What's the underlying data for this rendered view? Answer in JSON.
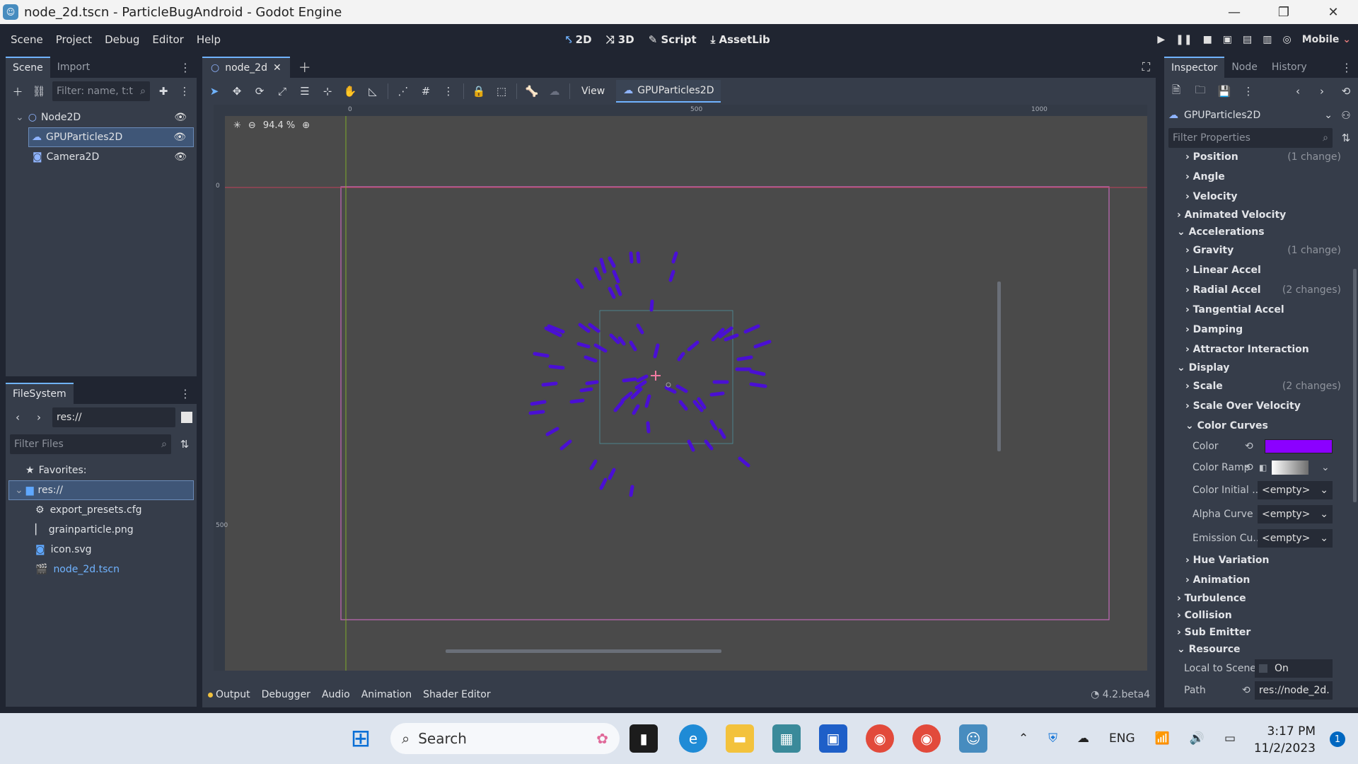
{
  "window": {
    "title": "node_2d.tscn - ParticleBugAndroid - Godot Engine",
    "minimize": "—",
    "restore": "❐",
    "close": "✕"
  },
  "menu": {
    "items": [
      "Scene",
      "Project",
      "Debug",
      "Editor",
      "Help"
    ],
    "workspaces": [
      "2D",
      "3D",
      "Script",
      "AssetLib"
    ],
    "active_workspace": "2D",
    "renderer": "Mobile"
  },
  "scene_dock": {
    "tabs": [
      "Scene",
      "Import"
    ],
    "filter_placeholder": "Filter: name, t:t",
    "nodes": [
      {
        "name": "Node2D",
        "type": "node2d"
      },
      {
        "name": "GPUParticles2D",
        "type": "particles",
        "selected": true
      },
      {
        "name": "Camera2D",
        "type": "camera"
      }
    ]
  },
  "filesystem": {
    "tab": "FileSystem",
    "path": "res://",
    "filter_placeholder": "Filter Files",
    "favorites_label": "Favorites:",
    "root": "res://",
    "files": [
      "export_presets.cfg",
      "grainparticle.png",
      "icon.svg",
      "node_2d.tscn"
    ]
  },
  "editor": {
    "tab": "node_2d",
    "view_label": "View",
    "selected_node": "GPUParticles2D",
    "zoom": "94.4 %",
    "ruler_marks": [
      "0",
      "500",
      "1000"
    ],
    "ruler_left_marks": [
      "0",
      "500"
    ]
  },
  "bottom_panel": {
    "tabs": [
      "Output",
      "Debugger",
      "Audio",
      "Animation",
      "Shader Editor"
    ],
    "version": "4.2.beta4"
  },
  "inspector": {
    "tabs": [
      "Inspector",
      "Node",
      "History"
    ],
    "object": "GPUParticles2D",
    "filter_placeholder": "Filter Properties",
    "rows": [
      {
        "kind": "sub",
        "label": "Position",
        "changes": "(1 change)"
      },
      {
        "kind": "sub",
        "label": "Angle",
        "changes": ""
      },
      {
        "kind": "sub",
        "label": "Velocity",
        "changes": ""
      },
      {
        "kind": "grp",
        "label": "Animated Velocity",
        "changes": ""
      },
      {
        "kind": "grp-open",
        "label": "Accelerations",
        "changes": ""
      },
      {
        "kind": "sub",
        "label": "Gravity",
        "changes": "(1 change)"
      },
      {
        "kind": "sub",
        "label": "Linear Accel",
        "changes": ""
      },
      {
        "kind": "sub",
        "label": "Radial Accel",
        "changes": "(2 changes)"
      },
      {
        "kind": "sub",
        "label": "Tangential Accel",
        "changes": ""
      },
      {
        "kind": "sub",
        "label": "Damping",
        "changes": ""
      },
      {
        "kind": "sub",
        "label": "Attractor Interaction",
        "changes": ""
      },
      {
        "kind": "grp-open",
        "label": "Display",
        "changes": ""
      },
      {
        "kind": "sub",
        "label": "Scale",
        "changes": "(2 changes)"
      },
      {
        "kind": "sub",
        "label": "Scale Over Velocity",
        "changes": ""
      },
      {
        "kind": "sub-open",
        "label": "Color Curves",
        "changes": ""
      }
    ],
    "color_curves": [
      {
        "label": "Color",
        "value": "",
        "type": "color"
      },
      {
        "label": "Color Ramp",
        "value": "",
        "type": "ramp"
      },
      {
        "label": "Color Initial ...",
        "value": "<empty>",
        "type": "select"
      },
      {
        "label": "Alpha Curve",
        "value": "<empty>",
        "type": "select"
      },
      {
        "label": "Emission Cu...",
        "value": "<empty>",
        "type": "select"
      }
    ],
    "rows_after": [
      {
        "kind": "sub",
        "label": "Hue Variation"
      },
      {
        "kind": "sub",
        "label": "Animation"
      },
      {
        "kind": "grp",
        "label": "Turbulence"
      },
      {
        "kind": "grp",
        "label": "Collision"
      },
      {
        "kind": "grp",
        "label": "Sub Emitter"
      },
      {
        "kind": "grp-open",
        "label": "Resource"
      }
    ],
    "resource": {
      "local_label": "Local to Scene",
      "local_value": "On",
      "path_label": "Path",
      "path_value": "res://node_2d."
    },
    "color_value": "#8b00ff"
  },
  "taskbar": {
    "search": "Search",
    "lang": "ENG",
    "time": "3:17 PM",
    "date": "11/2/2023",
    "notifications": "1"
  }
}
